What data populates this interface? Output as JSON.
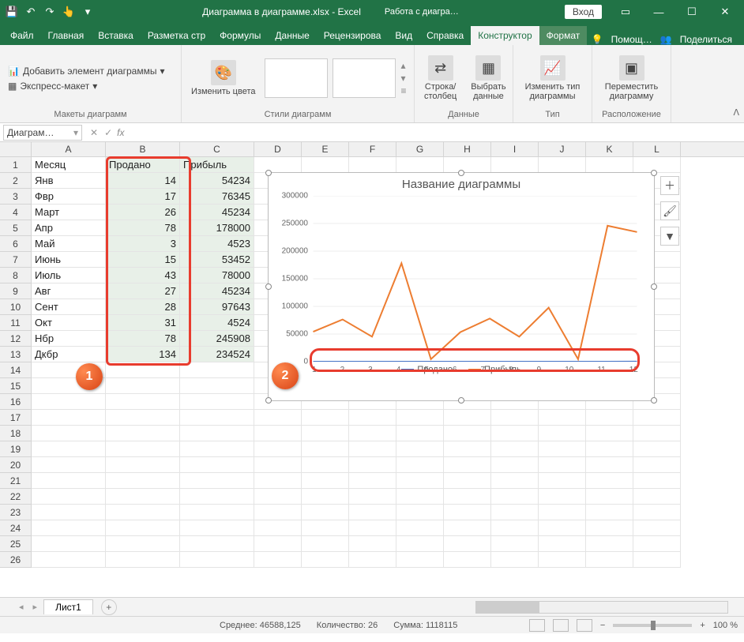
{
  "title": {
    "filename": "Диаграмма в диаграмме.xlsx",
    "app": "Excel",
    "separator": " -  ",
    "chart_tools": "Работа с диагра…",
    "login": "Вход"
  },
  "tabs": {
    "file": "Файл",
    "home": "Главная",
    "insert": "Вставка",
    "layout": "Разметка стр",
    "formulas": "Формулы",
    "data": "Данные",
    "review": "Рецензирова",
    "view": "Вид",
    "help": "Справка",
    "design": "Конструктор",
    "format": "Формат",
    "tell": "Помощ…",
    "share": "Поделиться"
  },
  "ribbon": {
    "add_element": "Добавить элемент диаграммы",
    "quick_layout": "Экспресс-макет",
    "group_layouts": "Макеты диаграмм",
    "change_colors": "Изменить цвета",
    "group_styles": "Стили диаграмм",
    "switch_rc": "Строка/столбец",
    "select_data": "Выбрать данные",
    "group_data": "Данные",
    "change_type": "Изменить тип диаграммы",
    "group_type": "Тип",
    "move_chart": "Переместить диаграмму",
    "group_location": "Расположение"
  },
  "formula": {
    "name_box": "Диаграм…",
    "fx": "fx"
  },
  "columns": [
    "A",
    "B",
    "C",
    "D",
    "E",
    "F",
    "G",
    "H",
    "I",
    "J",
    "K",
    "L"
  ],
  "headers": {
    "month": "Месяц",
    "sold": "Продано",
    "profit": "Прибыль"
  },
  "table": {
    "months": [
      "Янв",
      "Фвр",
      "Март",
      "Апр",
      "Май",
      "Июнь",
      "Июль",
      "Авг",
      "Сент",
      "Окт",
      "Нбр",
      "Дкбр"
    ],
    "sold": [
      14,
      17,
      26,
      78,
      3,
      15,
      43,
      27,
      28,
      31,
      78,
      134
    ],
    "profit": [
      54234,
      76345,
      45234,
      178000,
      4523,
      53452,
      78000,
      45234,
      97643,
      4524,
      245908,
      234524
    ]
  },
  "chart": {
    "title": "Название диаграммы",
    "legend_sold": "Продано",
    "legend_profit": "Прибыль",
    "y_ticks": [
      "0",
      "50000",
      "100000",
      "150000",
      "200000",
      "250000",
      "300000"
    ],
    "x_ticks": [
      "1",
      "2",
      "3",
      "4",
      "5",
      "6",
      "7",
      "8",
      "9",
      "10",
      "11",
      "12"
    ]
  },
  "chart_data": {
    "type": "line",
    "categories": [
      1,
      2,
      3,
      4,
      5,
      6,
      7,
      8,
      9,
      10,
      11,
      12
    ],
    "series": [
      {
        "name": "Продано",
        "values": [
          14,
          17,
          26,
          78,
          3,
          15,
          43,
          27,
          28,
          31,
          78,
          134
        ],
        "color": "#4472c4"
      },
      {
        "name": "Прибыль",
        "values": [
          54234,
          76345,
          45234,
          178000,
          4523,
          53452,
          78000,
          45234,
          97643,
          4524,
          245908,
          234524
        ],
        "color": "#ed7d31"
      }
    ],
    "title": "Название диаграммы",
    "ylim": [
      0,
      300000
    ],
    "xlabel": "",
    "ylabel": ""
  },
  "sheet_tabs": {
    "sheet1": "Лист1"
  },
  "status": {
    "avg_label": "Среднее:",
    "avg": "46588,125",
    "count_label": "Количество:",
    "count": "26",
    "sum_label": "Сумма:",
    "sum": "1118115",
    "zoom": "100 %"
  },
  "markers": {
    "one": "1",
    "two": "2"
  }
}
